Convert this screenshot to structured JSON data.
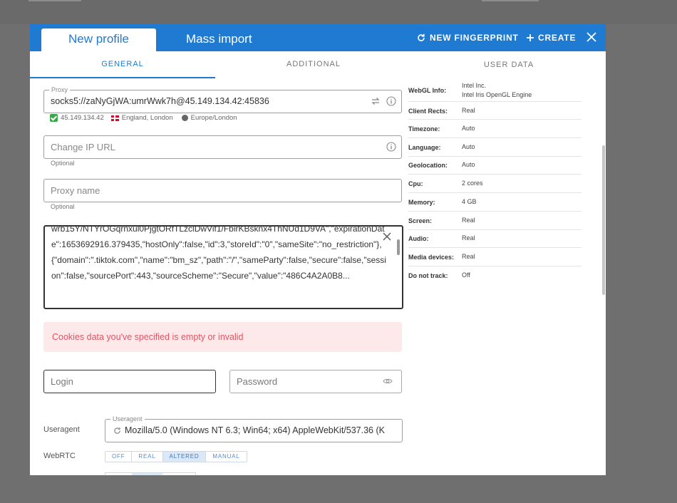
{
  "header": {
    "tab_new_profile": "New profile",
    "tab_mass_import": "Mass import",
    "new_fingerprint": "NEW FINGERPRINT",
    "create": "CREATE"
  },
  "subtabs": [
    "GENERAL",
    "ADDITIONAL",
    "USER DATA"
  ],
  "proxy": {
    "legend": "Proxy",
    "value": "socks5://zaNyGjWA:umrWwk7h@45.149.134.42:45836",
    "ip": "45.149.134.42",
    "location": "England, London",
    "timezone": "Europe/London"
  },
  "change_ip": {
    "placeholder": "Change IP URL",
    "hint": "Optional"
  },
  "proxy_name": {
    "placeholder": "Proxy name",
    "hint": "Optional"
  },
  "cookies": {
    "text": "wrb15Y/NTYrOGqrnxul0PjgtORfTLzclDwVif1/FbirKBsknx4ThNUd1D9VA\",\"expirationDate\":1653692916.379435,\"hostOnly\":false,\"id\":3,\"storeId\":\"0\",\"sameSite\":\"no_restriction\"},{\"domain\":\".tiktok.com\",\"name\":\"bm_sz\",\"path\":\"/\",\"sameParty\":false,\"secure\":false,\"session\":false,\"sourcePort\":443,\"sourceScheme\":\"Secure\",\"value\":\"486C4A2A0B8..."
  },
  "error": "Cookies data you've specified is empty or invalid",
  "login": {
    "placeholder": "Login"
  },
  "password": {
    "placeholder": "Password"
  },
  "useragent": {
    "label": "Useragent",
    "legend": "Useragent",
    "value": "Mozilla/5.0 (Windows NT 6.3; Win64; x64) AppleWebKit/537.36 (K"
  },
  "webrtc": {
    "label": "WebRTC",
    "options": [
      "OFF",
      "REAL",
      "ALTERED",
      "MANUAL"
    ],
    "selected": "ALTERED"
  },
  "fingerprint": [
    {
      "key": "WebGL Info:",
      "value": "Intel Inc.",
      "value2": "Intel Iris OpenGL Engine"
    },
    {
      "key": "Client Rects:",
      "value": "Real"
    },
    {
      "key": "Timezone:",
      "value": "Auto"
    },
    {
      "key": "Language:",
      "value": "Auto"
    },
    {
      "key": "Geolocation:",
      "value": "Auto"
    },
    {
      "key": "Cpu:",
      "value": "2 cores"
    },
    {
      "key": "Memory:",
      "value": "4 GB"
    },
    {
      "key": "Screen:",
      "value": "Real"
    },
    {
      "key": "Audio:",
      "value": "Real"
    },
    {
      "key": "Media devices:",
      "value": "Real"
    },
    {
      "key": "Do not track:",
      "value": "Off"
    }
  ]
}
